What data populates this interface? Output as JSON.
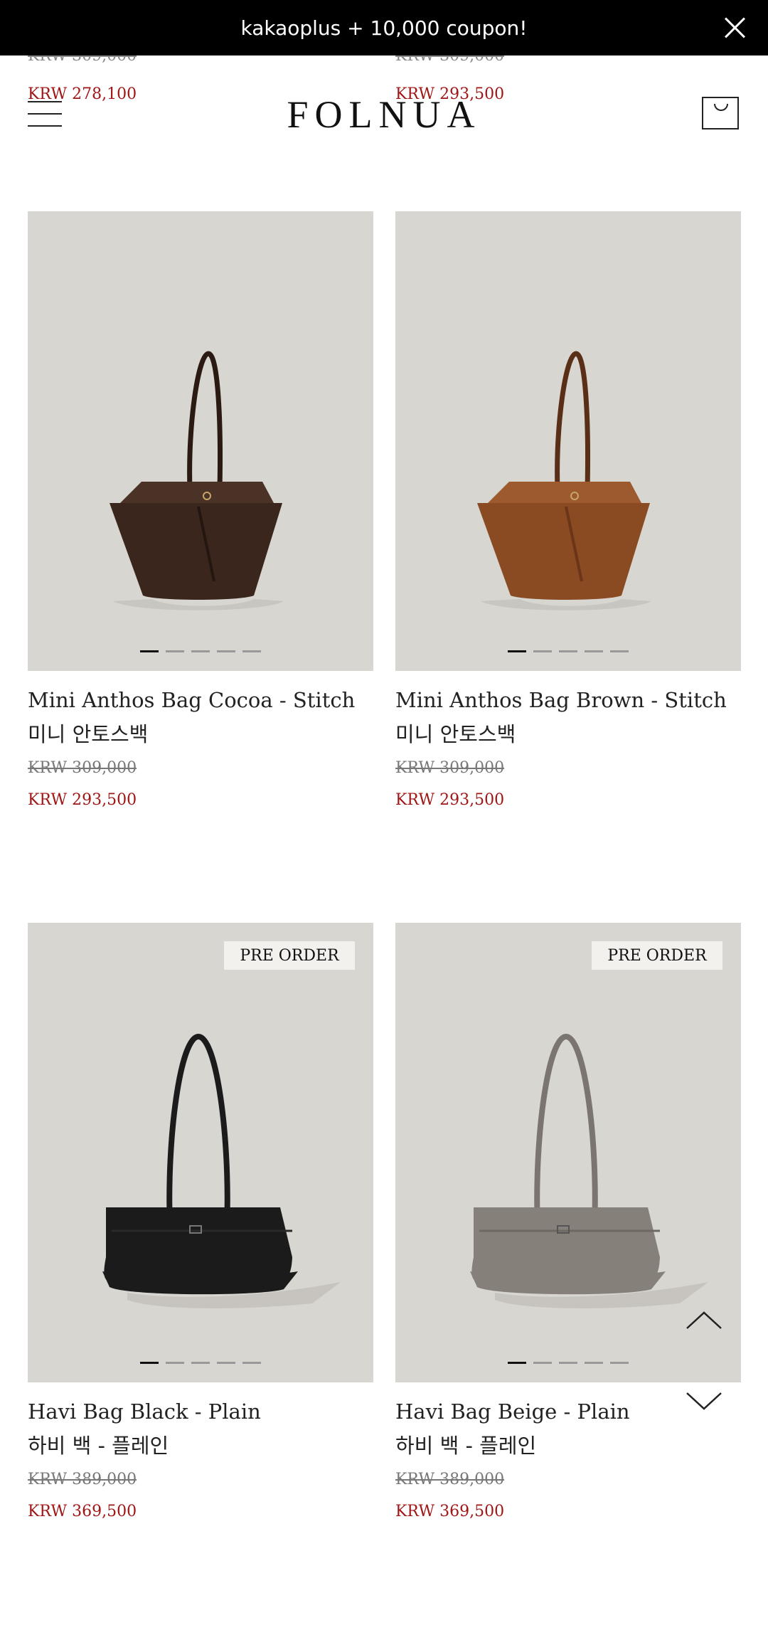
{
  "banner": {
    "text": "kakaoplus + 10,000 coupon!"
  },
  "header": {
    "logo": "FOLNUA"
  },
  "previous_row": [
    {
      "old_price": "KRW 309,000",
      "new_price": "KRW 278,100"
    },
    {
      "old_price": "KRW 309,000",
      "new_price": "KRW 293,500"
    }
  ],
  "products": [
    {
      "name": "Mini Anthos Bag Cocoa - Stitch",
      "korean_name": "미니 안토스백",
      "old_price": "KRW 309,000",
      "new_price": "KRW 293,500",
      "badge": "",
      "color": "#3a261c"
    },
    {
      "name": "Mini Anthos Bag Brown - Stitch",
      "korean_name": "미니 안토스백",
      "old_price": "KRW 309,000",
      "new_price": "KRW 293,500",
      "badge": "",
      "color": "#8a4a22"
    },
    {
      "name": "Havi Bag Black - Plain",
      "korean_name": "하비 백 - 플레인",
      "old_price": "KRW 389,000",
      "new_price": "KRW 369,500",
      "badge": "PRE ORDER",
      "color": "#1b1b1b"
    },
    {
      "name": "Havi Bag Beige - Plain",
      "korean_name": "하비 백 - 플레인",
      "old_price": "KRW 389,000",
      "new_price": "KRW 369,500",
      "badge": "PRE ORDER",
      "color": "#85817a"
    }
  ],
  "icons": [
    "close-icon",
    "hamburger-icon",
    "shopping-bag-icon",
    "chevron-up-icon",
    "chevron-down-icon"
  ]
}
